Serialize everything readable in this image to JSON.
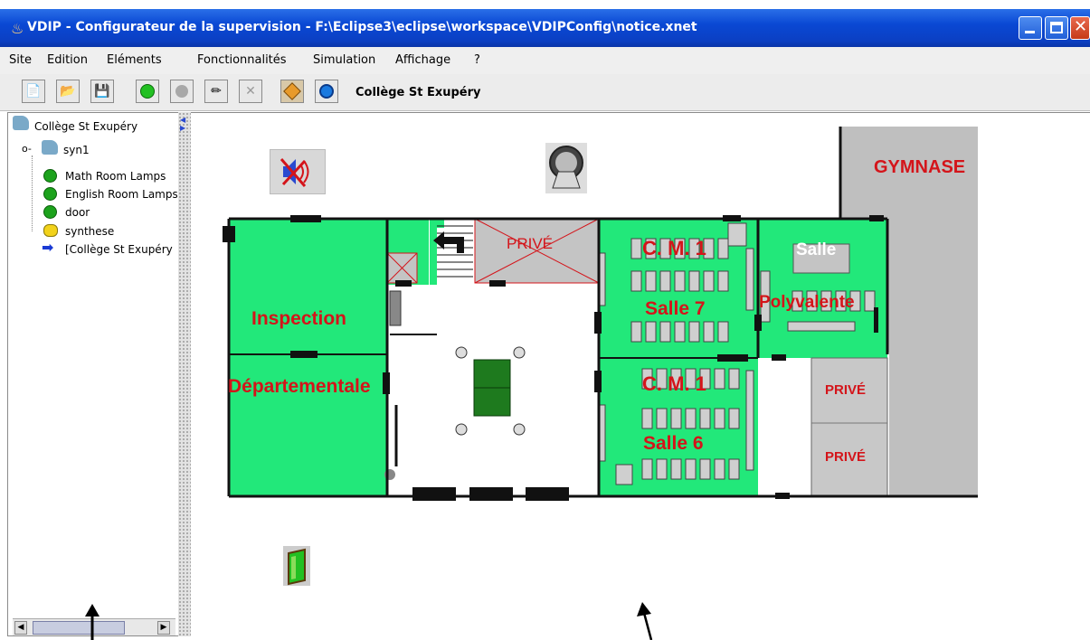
{
  "window": {
    "title": "VDIP - Configurateur de la supervision - F:\\Eclipse3\\eclipse\\workspace\\VDIPConfig\\notice.xnet"
  },
  "menu": [
    "Site",
    "Edition",
    "Eléments",
    "Fonctionnalités",
    "Simulation",
    "Affichage",
    "?"
  ],
  "toolbar": {
    "site_name": "Collège St Exupéry",
    "buttons": [
      "new-document-icon",
      "open-folder-icon",
      "save-icon",
      "add-element-icon",
      "disabled-element-icon",
      "pencil-icon",
      "delete-icon",
      "diamond-icon",
      "clock-icon"
    ]
  },
  "tree": {
    "root": "Collège St Exupéry",
    "syn": "syn1",
    "items": [
      "Math Room Lamps",
      "English Room Lamps",
      "door",
      "synthese",
      "[Collège St Exupéry"
    ]
  },
  "plan": {
    "gymnase": "GYMNASE",
    "prive_top": "PRIVÉ",
    "inspection": "Inspection",
    "departementale": "Départementale",
    "cm1_a": "C. M. 1",
    "salle7": "Salle 7",
    "cm1_b": "C. M. 1",
    "salle6": "Salle 6",
    "salle": "Salle",
    "polyvalente": "Polyvalente",
    "prive_r1": "PRIVÉ",
    "prive_r2": "PRIVÉ"
  },
  "colors": {
    "room_green": "#22e87a",
    "label_red": "#d4141a",
    "title_blue": "#0a48d4"
  }
}
